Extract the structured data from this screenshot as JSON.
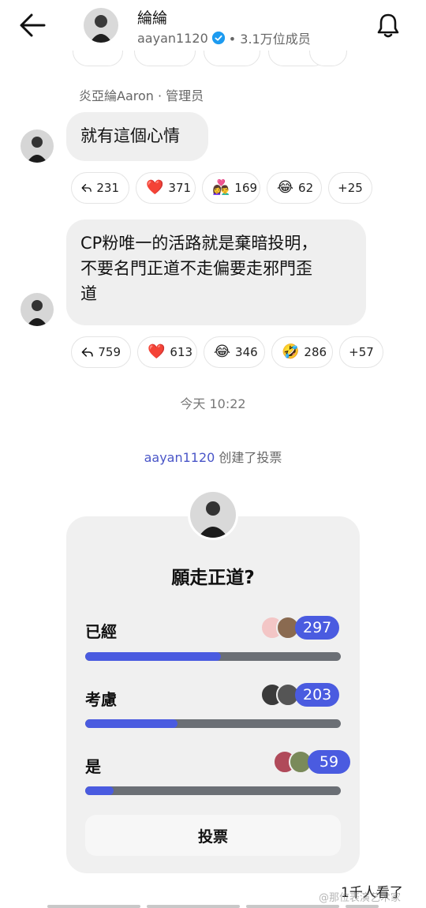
{
  "header": {
    "name": "綸綸",
    "username": "aayan1120",
    "members": "• 3.1万位成员"
  },
  "message1": {
    "sender": "炎亞綸Aaron · 管理员",
    "text": "就有這個心情",
    "reactions": [
      {
        "icon": "reply-icon",
        "count": "231"
      },
      {
        "emoji": "❤️",
        "count": "371"
      },
      {
        "emoji": "👩‍❤️‍👨",
        "count": "169"
      },
      {
        "emoji": "😂",
        "count": "62"
      },
      {
        "more": "+25"
      }
    ]
  },
  "message2": {
    "text_line1": "CP粉唯一的活路就是棄暗投明，",
    "text_line2": "不要名門正道不走偏要走邪門歪",
    "text_line3": "道",
    "reactions": [
      {
        "icon": "reply-icon",
        "count": "759"
      },
      {
        "emoji": "❤️",
        "count": "613"
      },
      {
        "emoji": "😂",
        "count": "346"
      },
      {
        "emoji": "🤣",
        "count": "286"
      },
      {
        "more": "+57"
      }
    ]
  },
  "timestamp": "今天 10:22",
  "poll_note": {
    "username": "aayan1120",
    "action": " 创建了投票"
  },
  "poll": {
    "question": "願走正道?",
    "options": [
      {
        "label": "已經",
        "count": "297",
        "fraction": 0.53
      },
      {
        "label": "考慮",
        "count": "203",
        "fraction": 0.36
      },
      {
        "label": "是",
        "count": "59",
        "fraction": 0.11
      }
    ],
    "vote_button": "投票"
  },
  "views": "1千人看了",
  "watermark": "@那位表演艺术家",
  "colors": {
    "accent": "#4a5be0",
    "bubble": "#efefef",
    "verified": "#1d9bf0"
  }
}
